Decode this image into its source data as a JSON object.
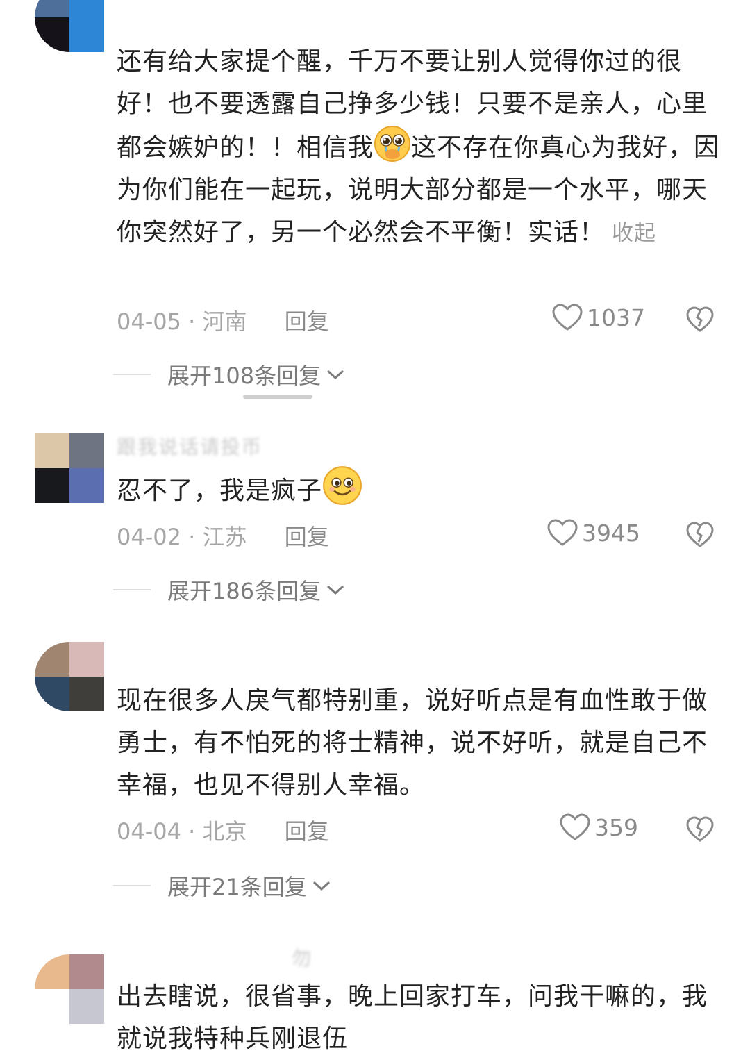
{
  "comments": [
    {
      "avatar_colors": [
        "#4d6f99",
        "#2e86d6",
        "#15121a",
        "#2e86d6"
      ],
      "body": "还有给大家提个醒，千万不要让别人觉得你过的很好！也不要透露自己挣多少钱！只要不是亲人，心里都会嫉妒的！！相信我",
      "emoji": "pleading-face-icon",
      "body_tail": "这不存在你真心为我好，因为你们能在一起玩，说明大部分都是一个水平，哪天你突然好了，另一个必然会不平衡！实话！",
      "collapse_label": "收起",
      "date": "04-05",
      "region": "河南",
      "reply_label": "回复",
      "likes": "1037",
      "expand_label": "展开108条回复"
    },
    {
      "avatar_colors": [
        "#dcc8a8",
        "#6f7482",
        "#18191d",
        "#5b6fb0"
      ],
      "username": "跟我说话请投币",
      "body": "忍不了，我是疯子",
      "emoji": "grinning-face-icon",
      "date": "04-02",
      "region": "江苏",
      "reply_label": "回复",
      "likes": "3945",
      "expand_label": "展开186条回复"
    },
    {
      "avatar_colors": [
        "#a08670",
        "#d9b8b8",
        "#2f4964",
        "#3f3e3a"
      ],
      "body": "现在很多人戾气都特别重，说好听点是有血性敢于做勇士，有不怕死的将士精神，说不好听，就是自己不幸福，也见不得别人幸福。",
      "date": "04-04",
      "region": "北京",
      "reply_label": "回复",
      "likes": "359",
      "expand_label": "展开21条回复"
    },
    {
      "avatar_colors": [
        "#e9b98e",
        "#b08a8c",
        "#ffffff",
        "#c7c7d2"
      ],
      "username": "勿",
      "body": "出去瞎说，很省事，晚上回家打车，问我干嘛的，我就说我特种兵刚退伍"
    }
  ]
}
